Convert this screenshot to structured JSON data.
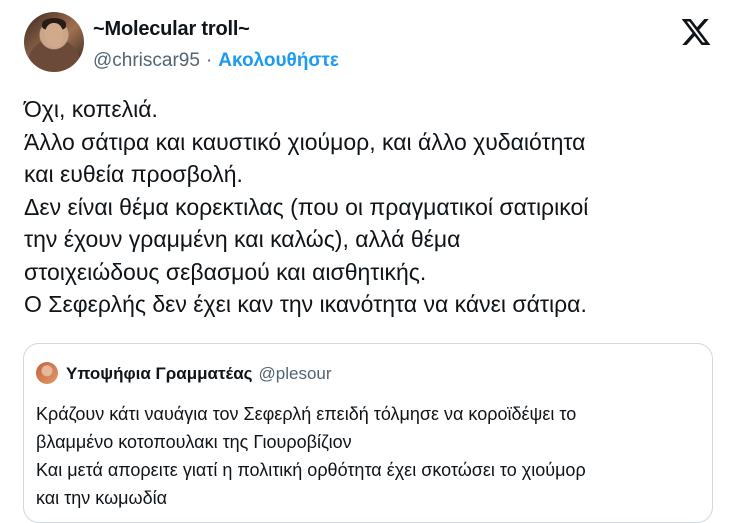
{
  "tweet": {
    "display_name": "~Molecular troll~",
    "handle": "@chriscar95",
    "separator": "·",
    "follow_label": "Ακολουθήστε",
    "text_lines": [
      "Όχι, κοπελιά.",
      "Άλλο σάτιρα και καυστικό χιούμορ, και άλλο χυδαιότητα",
      "και ευθεία προσβολή.",
      "Δεν είναι θέμα κορεκτιλας (που οι πραγματικοί σατιρικοί",
      "την έχουν γραμμένη και καλώς), αλλά θέμα",
      "στοιχειώδους σεβασμού και αισθητικής.",
      "Ο Σεφερλής δεν έχει καν την ικανότητα να κάνει σάτιρα."
    ]
  },
  "quote": {
    "display_name": "Υποψήφια Γραμματέας",
    "handle": "@plesour",
    "text_lines": [
      "Κράζουν κάτι ναυάγια τον Σεφερλή επειδή τόλμησε να κοροϊδέψει το",
      "βλαμμένο κοτοπουλακι της Γιουροβίζιον",
      "Και μετά απορειτε γιατί η πολιτική ορθότητα έχει σκοτώσει το χιούμορ",
      "και την κωμωδία"
    ]
  },
  "icons": {
    "logo": "x-logo-icon",
    "author_avatar": "avatar",
    "quote_avatar": "avatar"
  },
  "colors": {
    "text": "#0f1419",
    "secondary": "#536471",
    "link": "#1d9bf0",
    "border": "#cfd9de"
  }
}
